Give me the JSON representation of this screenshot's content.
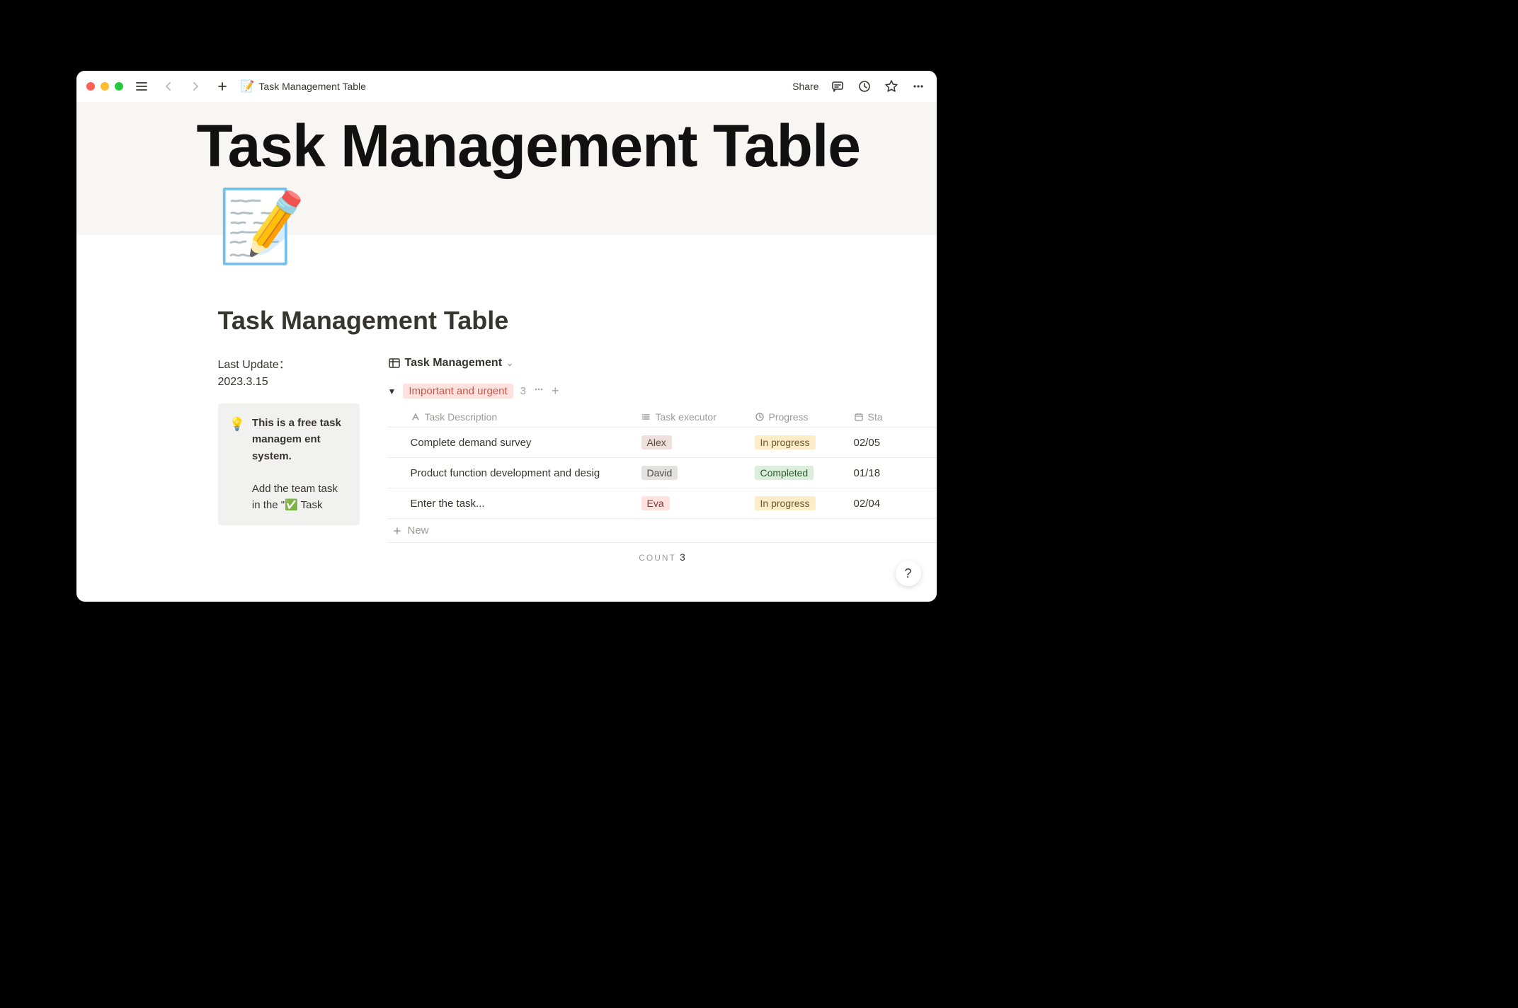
{
  "titlebar": {
    "breadcrumb_icon": "📝",
    "breadcrumb_title": "Task Management Table",
    "share_label": "Share"
  },
  "cover": {
    "big_title": "Task Management Table",
    "page_icon": "📝"
  },
  "page": {
    "title": "Task Management Table"
  },
  "sidebar": {
    "last_update_label": "Last Update：",
    "last_update_value": "2023.3.15",
    "callout_icon": "💡",
    "callout_bold": "This is a free task managem ent system.",
    "callout_rest": "Add the team task in the \"✅ Task"
  },
  "database": {
    "view_name": "Task Management",
    "group_label": "Important and urgent",
    "group_count": "3",
    "columns": {
      "desc": "Task Description",
      "exec": "Task executor",
      "prog": "Progress",
      "date": "Sta"
    },
    "rows": [
      {
        "desc": "Complete demand survey",
        "exec": "Alex",
        "exec_class": "alex",
        "prog": "In progress",
        "prog_class": "inprog",
        "date": "02/05"
      },
      {
        "desc": "Product function development and desig",
        "exec": "David",
        "exec_class": "david",
        "prog": "Completed",
        "prog_class": "done",
        "date": "01/18"
      },
      {
        "desc": "Enter the task...",
        "exec": "Eva",
        "exec_class": "eva",
        "prog": "In progress",
        "prog_class": "inprog",
        "date": "02/04"
      }
    ],
    "new_label": "New",
    "footer_label": "COUNT",
    "footer_value": "3"
  },
  "help": "?"
}
